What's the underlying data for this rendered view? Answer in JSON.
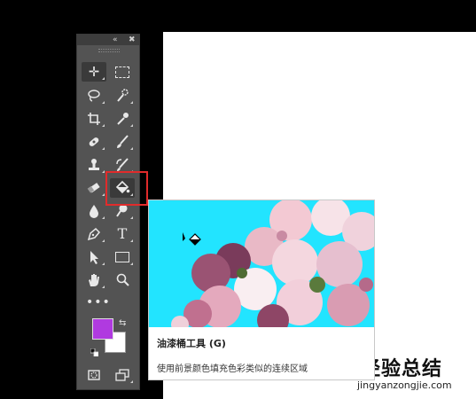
{
  "toolbar": {
    "collapse_glyph": "«",
    "close_glyph": "✖",
    "more_glyph": "•••",
    "swap_glyph": "⇆",
    "tools": [
      {
        "name": "move-tool",
        "icon": "move-icon",
        "glyph": "✛"
      },
      {
        "name": "marquee-tool",
        "icon": "marquee-icon",
        "glyph": "⬚"
      },
      {
        "name": "lasso-tool",
        "icon": "lasso-icon",
        "glyph": "✧"
      },
      {
        "name": "quick-select-tool",
        "icon": "quick-select-icon",
        "glyph": "✎"
      },
      {
        "name": "crop-tool",
        "icon": "crop-icon",
        "glyph": "⯐"
      },
      {
        "name": "eyedropper-tool",
        "icon": "eyedropper-icon",
        "glyph": "✒"
      },
      {
        "name": "healing-brush-tool",
        "icon": "bandage-icon",
        "glyph": "✷"
      },
      {
        "name": "brush-tool",
        "icon": "brush-icon",
        "glyph": "✏"
      },
      {
        "name": "clone-stamp-tool",
        "icon": "stamp-icon",
        "glyph": "♙"
      },
      {
        "name": "history-brush-tool",
        "icon": "history-brush-icon",
        "glyph": "✐"
      },
      {
        "name": "eraser-tool",
        "icon": "eraser-icon",
        "glyph": "▭"
      },
      {
        "name": "paint-bucket-tool",
        "icon": "paint-bucket-icon",
        "glyph": ""
      },
      {
        "name": "blur-tool",
        "icon": "drop-icon",
        "glyph": "▲"
      },
      {
        "name": "dodge-tool",
        "icon": "dodge-icon",
        "glyph": "●"
      },
      {
        "name": "pen-tool",
        "icon": "pen-icon",
        "glyph": "✒"
      },
      {
        "name": "type-tool",
        "icon": "type-icon",
        "glyph": "T"
      },
      {
        "name": "path-select-tool",
        "icon": "arrow-icon",
        "glyph": "➤"
      },
      {
        "name": "rectangle-tool",
        "icon": "rectangle-icon",
        "glyph": "▭"
      },
      {
        "name": "hand-tool",
        "icon": "hand-icon",
        "glyph": "✋"
      },
      {
        "name": "zoom-tool",
        "icon": "zoom-icon",
        "glyph": "⌕"
      }
    ],
    "quick_mask_glyph": "◌",
    "screen_mode_glyph": "⧉",
    "foreground_color": "#b03ae0",
    "background_color": "#ffffff"
  },
  "tooltip": {
    "title": "油漆桶工具 (G)",
    "description": "使用前景颜色填充色彩类似的连续区域",
    "preview_bg": "#22e4ff"
  },
  "highlight_color": "#e12b2b",
  "watermark": {
    "main": "经验总结",
    "sub": "jingyanzongjie.com"
  }
}
